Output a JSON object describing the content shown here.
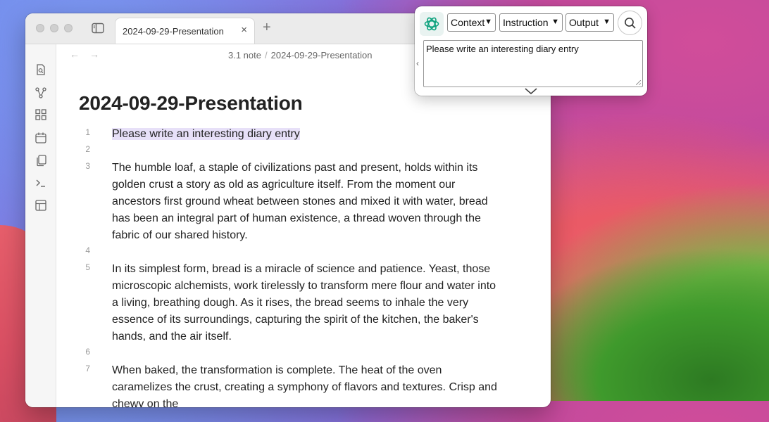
{
  "window": {
    "tab_title": "2024-09-29-Presentation",
    "tab_close": "×",
    "new_tab": "+"
  },
  "nav": {
    "back": "←",
    "forward": "→",
    "breadcrumb": [
      "3.1 note",
      "2024-09-29-Presentation"
    ],
    "breadcrumb_sep": "/"
  },
  "ribbon_icons": [
    "open-file-icon",
    "graph-icon",
    "blocks-icon",
    "calendar-icon",
    "copy-icon",
    "terminal-icon",
    "layout-icon"
  ],
  "document": {
    "title": "2024-09-29-Presentation",
    "lines": [
      {
        "num": "1",
        "text": "Please write an interesting diary entry"
      },
      {
        "num": "2",
        "text": ""
      },
      {
        "num": "3",
        "text": "The humble loaf, a staple of civilizations past and present, holds within its golden crust a story as old as agriculture itself. From the moment our ancestors first ground wheat between stones and mixed it with water, bread has been an integral part of human existence, a thread woven through the fabric of our shared history."
      },
      {
        "num": "4",
        "text": ""
      },
      {
        "num": "5",
        "text": "In its simplest form, bread is a miracle of science and patience. Yeast, those microscopic alchemists, work tirelessly to transform mere flour and water into a living, breathing dough. As it rises, the bread seems to inhale the very essence of its surroundings, capturing the spirit of the kitchen, the baker's hands, and the air itself."
      },
      {
        "num": "6",
        "text": ""
      },
      {
        "num": "7",
        "text": "When baked, the transformation is complete. The heat of the oven caramelizes the crust, creating a symphony of flavors and textures. Crisp and chewy on the"
      }
    ]
  },
  "ai_panel": {
    "select_context": "Context",
    "select_instruction": "Instruction",
    "select_output": "Output",
    "chevron": "⌄",
    "left_arrow": "‹",
    "prompt_value": "Please write an interesting diary entry",
    "accent": "#10a37f"
  }
}
